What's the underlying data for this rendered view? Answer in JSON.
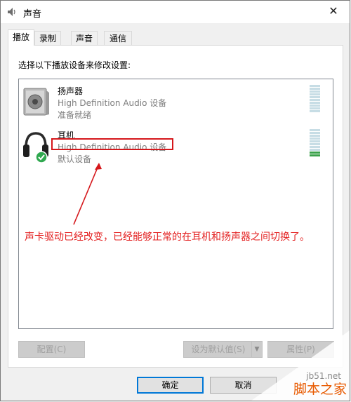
{
  "window": {
    "title": "声音",
    "close_glyph": "✕",
    "title_icon": "speaker-icon"
  },
  "tabs": [
    {
      "label": "播放",
      "active": true
    },
    {
      "label": "录制",
      "active": false
    },
    {
      "label": "声音",
      "active": false
    },
    {
      "label": "通信",
      "active": false
    }
  ],
  "panel": {
    "instruction": "选择以下播放设备来修改设置:"
  },
  "devices": [
    {
      "name": "扬声器",
      "description": "High Definition Audio 设备",
      "status": "准备就绪",
      "icon": "speaker-device-icon",
      "meter_level": 0
    },
    {
      "name": "耳机",
      "description": "High Definition Audio 设备",
      "status": "默认设备",
      "icon": "headphones-icon",
      "default_badge": "check-icon",
      "meter_level": 0.2
    }
  ],
  "annotation": {
    "text": "声卡驱动已经改变，已经能够正常的在耳机和扬声器之间切换了。",
    "color": "#e31e1e"
  },
  "buttons": {
    "configure": "配置(C)",
    "set_default": "设为默认值(S)",
    "set_default_arrow": "▼",
    "properties": "属性(P)",
    "ok": "确定",
    "cancel": "取消"
  },
  "watermark": {
    "site": "jb51.net",
    "brand": "脚本之家"
  },
  "colors": {
    "accent": "#0078d7",
    "annotation_red": "#d5171b",
    "meter_green": "#3aa14a"
  }
}
